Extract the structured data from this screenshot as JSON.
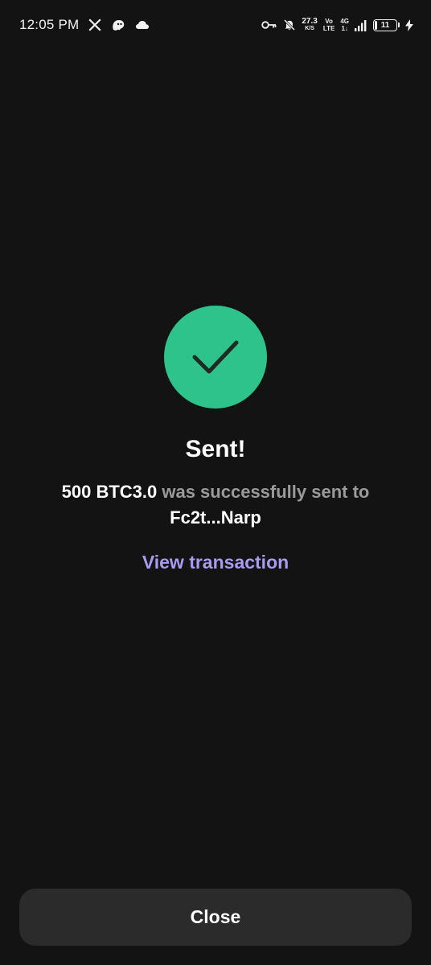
{
  "status_bar": {
    "time": "12:05 PM",
    "left_icons": [
      "x-icon",
      "ghost-icon",
      "cloud-icon"
    ],
    "net_speed_value": "27.3",
    "net_speed_unit": "K/S",
    "volte_top": "Vo",
    "volte_bottom": "LTE",
    "network_top": "4G",
    "network_bottom": "1↓",
    "battery_level": "11",
    "battery_fraction": 0.11,
    "right_icons": [
      "key-icon",
      "bell-off-icon",
      "signal-icon",
      "battery-icon",
      "charging-icon"
    ]
  },
  "result": {
    "title": "Sent!",
    "amount": "500 BTC3.0",
    "message_mid": " was successfully sent to ",
    "recipient": "Fc2t...Narp",
    "view_link": "View transaction"
  },
  "footer": {
    "close_label": "Close"
  },
  "colors": {
    "background": "#131313",
    "success": "#2dc38b",
    "link": "#a99bf0",
    "button": "#2b2b2b",
    "muted_text": "#9a9a9a"
  }
}
